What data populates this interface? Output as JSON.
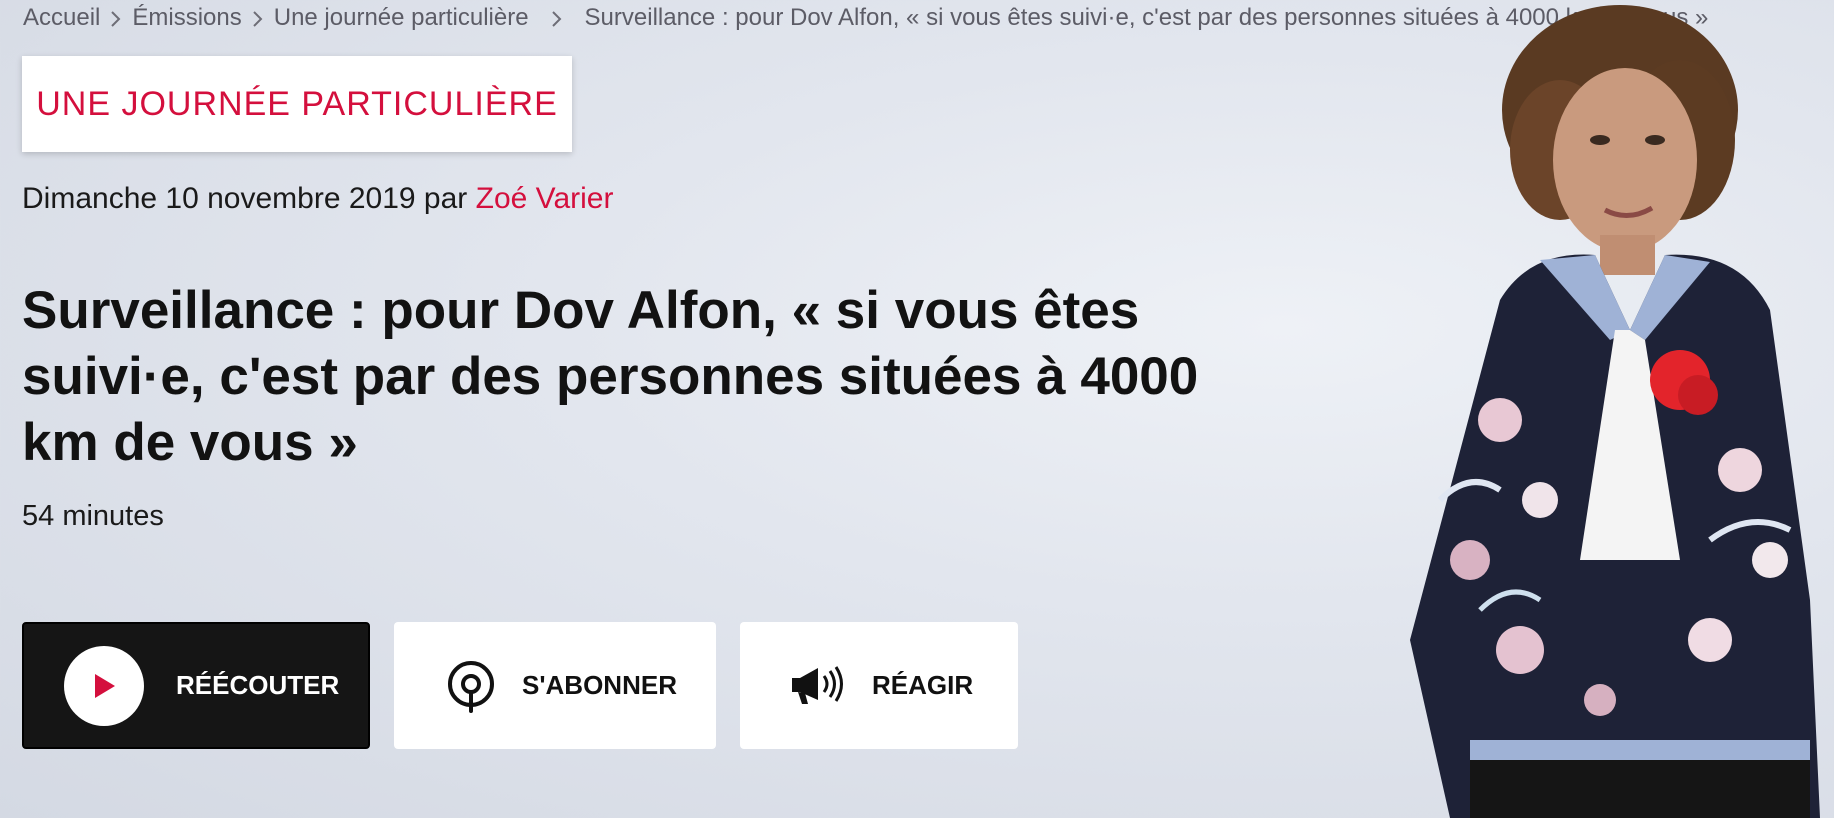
{
  "breadcrumb": {
    "items": [
      "Accueil",
      "Émissions",
      "Une journée particulière"
    ],
    "current": "Surveillance : pour Dov Alfon, « si vous êtes suivi·e, c'est par des personnes situées à 4000 km de vous »"
  },
  "show": {
    "name": "UNE JOURNÉE PARTICULIÈRE"
  },
  "meta": {
    "date": "Dimanche 10 novembre 2019",
    "by": "par",
    "author": "Zoé Varier"
  },
  "episode": {
    "title": "Surveillance : pour Dov Alfon, « si vous êtes suivi·e, c'est par des personnes situées à 4000 km de vous »",
    "duration": "54 minutes"
  },
  "actions": {
    "replay": "RÉÉCOUTER",
    "subscribe": "S'ABONNER",
    "react": "RÉAGIR"
  },
  "colors": {
    "accent": "#d40f3d",
    "dark_button": "#151515",
    "background": "#e2e6ee"
  },
  "icons": {
    "breadcrumb_separator": "chevron-right-icon",
    "replay": "play-icon",
    "subscribe": "podcast-icon",
    "react": "megaphone-icon"
  }
}
